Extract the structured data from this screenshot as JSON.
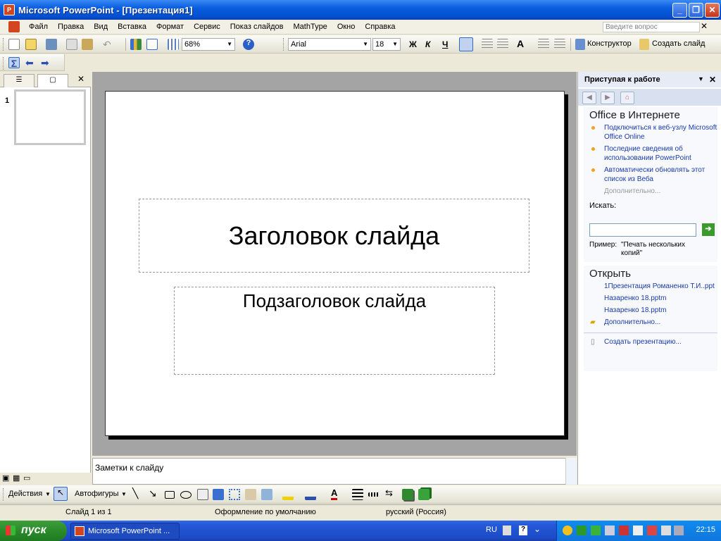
{
  "window": {
    "title": "Microsoft PowerPoint - [Презентация1]"
  },
  "menu": {
    "items": [
      "Файл",
      "Правка",
      "Вид",
      "Вставка",
      "Формат",
      "Сервис",
      "Показ слайдов",
      "MathType",
      "Окно",
      "Справка"
    ],
    "help_placeholder": "Введите вопрос"
  },
  "toolbar": {
    "zoom": "68%",
    "font": "Arial",
    "size": "18",
    "bold": "Ж",
    "italic": "К",
    "underline": "Ч",
    "designer": "Конструктор",
    "new_slide": "Создать слайд"
  },
  "slide": {
    "number": "1",
    "title": "Заголовок слайда",
    "subtitle": "Подзаголовок слайда"
  },
  "notes": {
    "placeholder": "Заметки к слайду"
  },
  "taskpane": {
    "header": "Приступая к работе",
    "online_heading": "Office в Интернете",
    "online_links": [
      "Подключиться к веб-узлу Microsoft Office Online",
      "Последние сведения об использовании PowerPoint",
      "Автоматически обновлять этот список из Веба"
    ],
    "more_online": "Дополнительно...",
    "search_label": "Искать:",
    "example_label": "Пример:",
    "example_text": "\"Печать нескольких копий\"",
    "open_heading": "Открыть",
    "recent_files": [
      "1Презентация Романенко Т.И..ppt",
      "Назаренко 18.pptm",
      "Назаренко 18.pptm"
    ],
    "more_open": "Дополнительно...",
    "create": "Создать презентацию..."
  },
  "drawbar": {
    "actions": "Действия",
    "autoshapes": "Автофигуры"
  },
  "status": {
    "slide_counter": "Слайд 1 из 1",
    "design": "Оформление по умолчанию",
    "language": "русский (Россия)"
  },
  "taskbar": {
    "start": "пуск",
    "app_item": "Microsoft PowerPoint ...",
    "lang": "RU",
    "clock": "22:15"
  }
}
